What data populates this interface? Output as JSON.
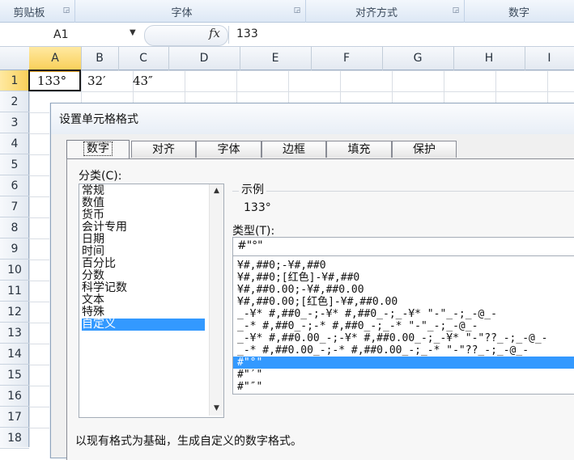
{
  "ribbon": {
    "groups": [
      {
        "label": "剪贴板"
      },
      {
        "label": "字体"
      },
      {
        "label": "对齐方式"
      },
      {
        "label": "数字"
      }
    ]
  },
  "formula_bar": {
    "name_box": "A1",
    "fx_label": "fx",
    "value": "133"
  },
  "sheet": {
    "columns": [
      "A",
      "B",
      "C",
      "D",
      "E",
      "F",
      "G",
      "H",
      "I"
    ],
    "rows": [
      "1",
      "2",
      "3",
      "4",
      "5",
      "6",
      "7",
      "8",
      "9",
      "10",
      "11",
      "12",
      "13",
      "14",
      "15",
      "16",
      "17",
      "18"
    ],
    "cells": {
      "A1": "133°",
      "B1": "32′",
      "C1": "43″"
    },
    "selected_cell": "A1"
  },
  "dialog": {
    "title": "设置单元格格式",
    "tabs": [
      {
        "label": "数字",
        "active": true
      },
      {
        "label": "对齐",
        "active": false
      },
      {
        "label": "字体",
        "active": false
      },
      {
        "label": "边框",
        "active": false
      },
      {
        "label": "填充",
        "active": false
      },
      {
        "label": "保护",
        "active": false
      }
    ],
    "category_label": "分类(C):",
    "categories": [
      "常规",
      "数值",
      "货币",
      "会计专用",
      "日期",
      "时间",
      "百分比",
      "分数",
      "科学记数",
      "文本",
      "特殊",
      "自定义"
    ],
    "selected_category": "自定义",
    "sample_label": "示例",
    "sample_value": "133°",
    "type_label": "类型(T):",
    "type_value": "#\"°\"",
    "format_list": [
      "¥#,##0;-¥#,##0",
      "¥#,##0;[红色]-¥#,##0",
      "¥#,##0.00;-¥#,##0.00",
      "¥#,##0.00;[红色]-¥#,##0.00",
      "_-¥* #,##0_-;-¥* #,##0_-;_-¥* \"-\"_-;_-@_-",
      "_-* #,##0_-;-* #,##0_-;_-* \"-\"_-;_-@_-",
      "_-¥* #,##0.00_-;-¥* #,##0.00_-;_-¥* \"-\"??_-;_-@_-",
      "_-* #,##0.00_-;-* #,##0.00_-;_-* \"-\"??_-;_-@_-",
      "#\"°\"",
      "#\"′\"",
      "#\"″\""
    ],
    "selected_format": "#\"°\"",
    "description": "以现有格式为基础，生成自定义的数字格式。"
  }
}
